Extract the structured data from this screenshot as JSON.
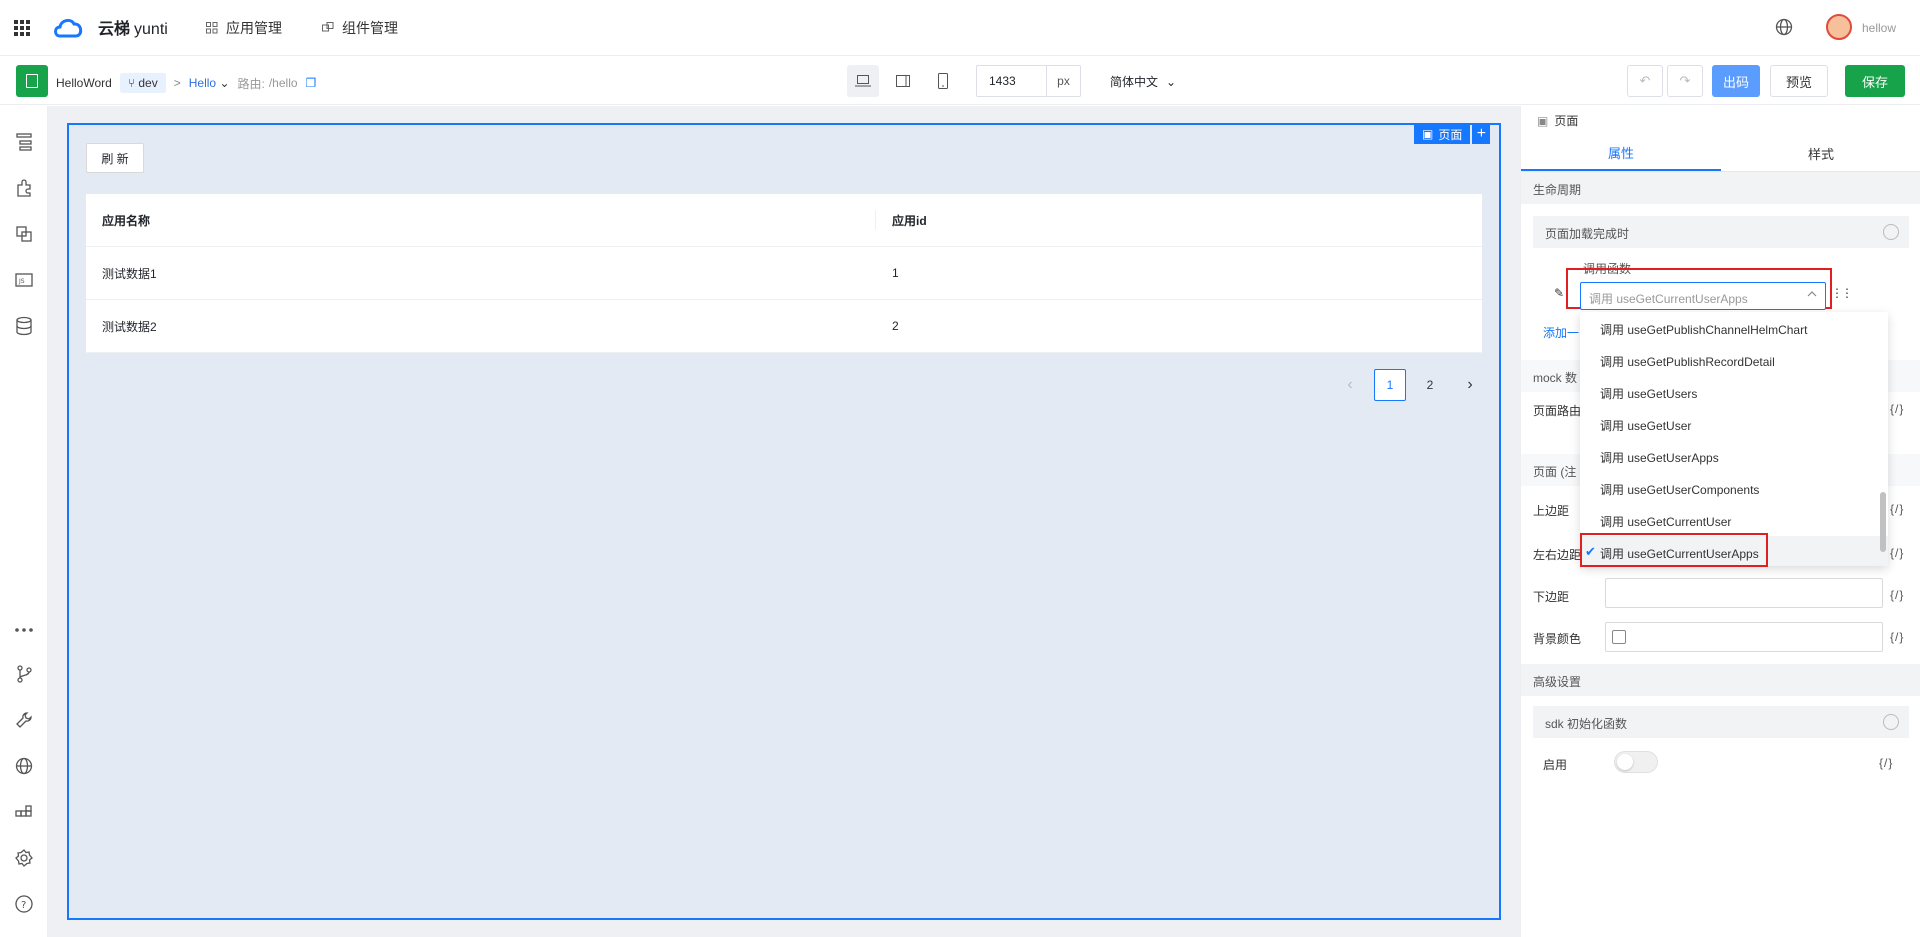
{
  "app": {
    "brand_cn": "云梯",
    "brand_en": "yunti",
    "user": "hellow"
  },
  "topnav": [
    {
      "label": "应用管理",
      "icon": "apps-icon"
    },
    {
      "label": "组件管理",
      "icon": "components-icon"
    }
  ],
  "toolbar": {
    "app_name": "HelloWord",
    "branch": "dev",
    "page": "Hello",
    "route_label": "路由:",
    "route": "/hello",
    "width_value": "1433",
    "width_unit": "px",
    "language": "简体中文",
    "out_label": "出码",
    "preview_label": "预览",
    "save_label": "保存"
  },
  "canvas": {
    "page_tag": "页面",
    "refresh_label": "刷 新",
    "table": {
      "columns": [
        "应用名称",
        "应用id"
      ],
      "rows": [
        [
          "测试数据1",
          "1"
        ],
        [
          "测试数据2",
          "2"
        ]
      ]
    },
    "pager": {
      "pages": [
        "1",
        "2"
      ],
      "current": "1",
      "prev": "‹",
      "next": "›"
    }
  },
  "panel": {
    "header": "页面",
    "tabs": [
      "属性",
      "样式"
    ],
    "lifecycle": {
      "title": "生命周期",
      "event": "页面加载完成时",
      "call_label": "调用函数",
      "selected": "调用 useGetCurrentUserApps",
      "add_label": "添加一"
    },
    "dropdown": [
      "调用 useGetPublishChannelHelmChart",
      "调用 useGetPublishRecordDetail",
      "调用 useGetUsers",
      "调用 useGetUser",
      "调用 useGetUserApps",
      "调用 useGetUserComponents",
      "调用 useGetCurrentUser",
      "调用 useGetCurrentUserApps"
    ],
    "mock_title": "mock 数",
    "route_param": "页面路由",
    "page_section": "页面 (注",
    "fields": {
      "top_margin": "上边距",
      "lr_margin": "左右边距",
      "bottom_margin": "下边距",
      "bg_color": "背景颜色"
    },
    "brace": "{/}",
    "advanced": {
      "title": "高级设置",
      "sdk": "sdk 初始化函数",
      "enable": "启用"
    }
  },
  "colors": {
    "primary": "#1677ff",
    "save": "#16a34a",
    "highlight": "#e02020"
  }
}
